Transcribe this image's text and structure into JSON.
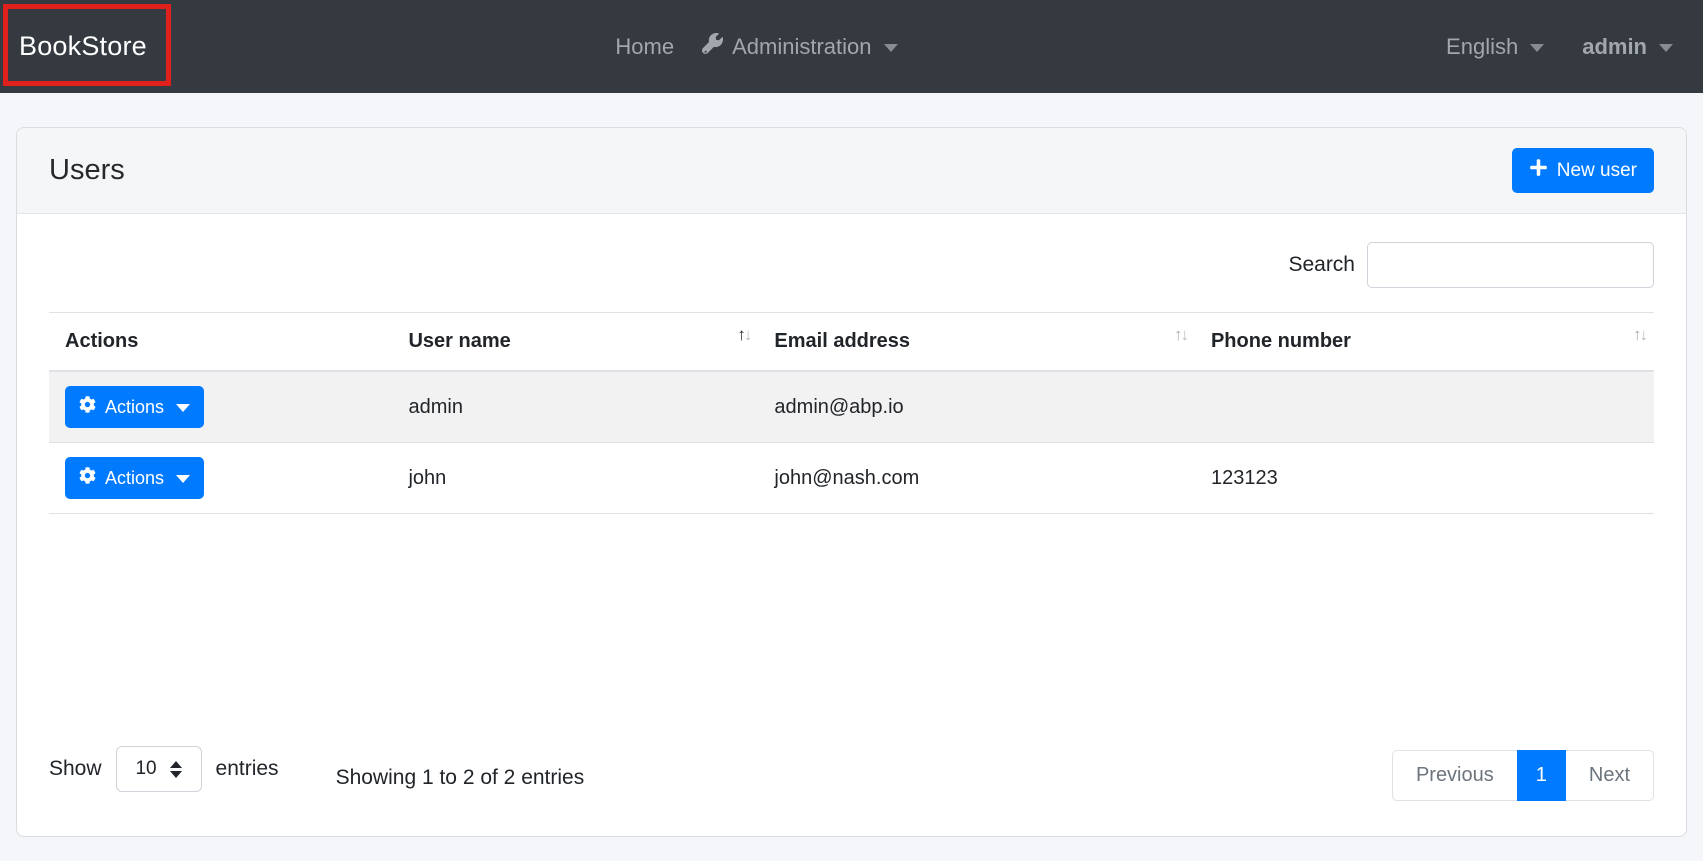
{
  "navbar": {
    "brand": "BookStore",
    "home_label": "Home",
    "administration_label": "Administration",
    "language_label": "English",
    "user_label": "admin"
  },
  "page": {
    "title": "Users",
    "new_user_label": "New user"
  },
  "search": {
    "label": "Search",
    "value": "",
    "placeholder": ""
  },
  "table": {
    "columns": [
      {
        "label": "Actions",
        "sortable": false,
        "sort_state": "none"
      },
      {
        "label": "User name",
        "sortable": true,
        "sort_state": "asc"
      },
      {
        "label": "Email address",
        "sortable": true,
        "sort_state": "none"
      },
      {
        "label": "Phone number",
        "sortable": true,
        "sort_state": "none"
      }
    ],
    "action_button_label": "Actions",
    "rows": [
      {
        "user_name": "admin",
        "email": "admin@abp.io",
        "phone": ""
      },
      {
        "user_name": "john",
        "email": "john@nash.com",
        "phone": "123123"
      }
    ]
  },
  "footer": {
    "show_label": "Show",
    "page_size": "10",
    "entries_label": "entries",
    "info": "Showing 1 to 2 of 2 entries",
    "pagination": {
      "previous": "Previous",
      "pages": [
        "1"
      ],
      "active_page": "1",
      "next": "Next"
    }
  },
  "icons": {
    "sort_up": "↑",
    "sort_down": "↓",
    "plus": "+"
  },
  "colors": {
    "primary": "#007bff",
    "navbar_bg": "#343a40",
    "annotation_red": "#df201d",
    "row_stripe": "#f2f2f2",
    "page_bg": "#f4f6f9"
  }
}
